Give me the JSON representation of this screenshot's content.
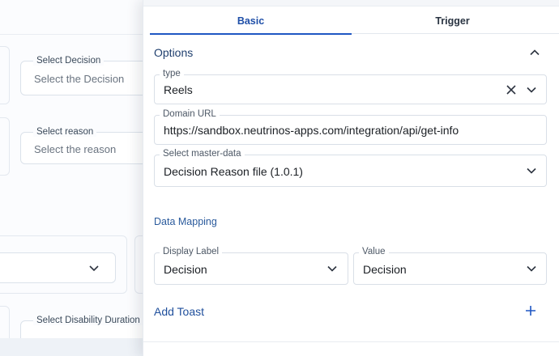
{
  "background": {
    "decision_field": {
      "label": "Select Decision",
      "placeholder": "Select the Decision"
    },
    "reason_field": {
      "label": "Select reason",
      "placeholder": "Select the reason"
    },
    "duration_field": {
      "label": "Select Disability Duration"
    }
  },
  "tabs": [
    {
      "label": "Basic",
      "active": true
    },
    {
      "label": "Trigger",
      "active": false
    }
  ],
  "options": {
    "title": "Options",
    "type_field": {
      "label": "type",
      "value": "Reels"
    },
    "domain_field": {
      "label": "Domain URL",
      "value": "https://sandbox.neutrinos-apps.com/integration/api/get-info"
    },
    "master_data_field": {
      "label": "Select master-data",
      "value": "Decision Reason file (1.0.1)"
    }
  },
  "data_mapping": {
    "title": "Data Mapping",
    "display_label_field": {
      "label": "Display Label",
      "value": "Decision"
    },
    "value_field": {
      "label": "Value",
      "value": "Decision"
    }
  },
  "toast": {
    "label": "Add Toast"
  },
  "icons": {
    "collapse": "chevron-up-icon",
    "clear": "close-icon",
    "dropdown": "chevron-down-icon",
    "add": "plus-icon"
  },
  "colors": {
    "accent": "#1f57c3",
    "title": "#1f3f6e",
    "link": "#1f4f9c"
  }
}
